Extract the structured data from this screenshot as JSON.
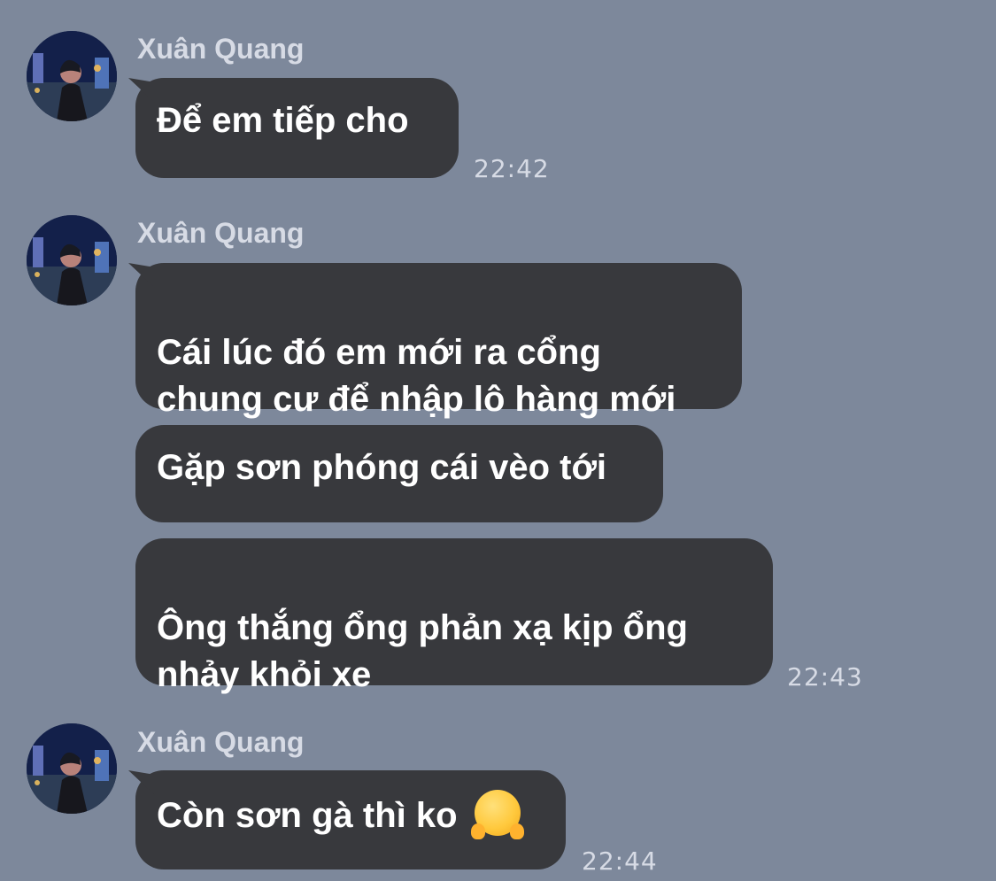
{
  "messages": [
    {
      "sender": "Xuân Quang",
      "bubbles": [
        "Để em tiếp cho"
      ],
      "time": "22:42"
    },
    {
      "sender": "Xuân Quang",
      "bubbles": [
        "Cái lúc đó em mới ra cổng\nchung cư để nhập lô hàng mới",
        "Gặp sơn phóng cái vèo tới",
        "Ông thắng ổng phản xạ kịp ổng\nnhảy khỏi xe"
      ],
      "time": "22:43"
    },
    {
      "sender": "Xuân Quang",
      "bubbles": [
        "Còn sơn gà thì ko"
      ],
      "emoji": "hugging-face-icon",
      "time": "22:44"
    }
  ],
  "colors": {
    "background": "#7d889b",
    "bubble": "#38393d",
    "text": "#ffffff",
    "meta": "#d7dbe5"
  }
}
